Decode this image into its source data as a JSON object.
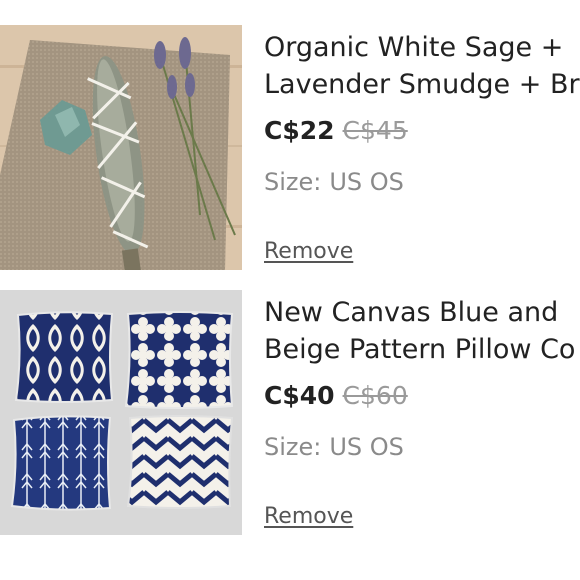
{
  "items": [
    {
      "title_lines": [
        "Organic White Sage +",
        "Lavender Smudge + Br."
      ],
      "price": "C$22",
      "original_price": "C$45",
      "size_label": "Size:",
      "size_value": "US OS",
      "remove_label": "Remove",
      "image": "sage-smudge-stick-with-lavender-and-crystal"
    },
    {
      "title_lines": [
        "New Canvas Blue and",
        "Beige Pattern Pillow Co"
      ],
      "price": "C$40",
      "original_price": "C$60",
      "size_label": "Size:",
      "size_value": "US OS",
      "remove_label": "Remove",
      "image": "four-navy-patterned-pillow-covers"
    }
  ],
  "colors": {
    "navy": "#1f2f6e",
    "burlap": "#a89a85",
    "wood": "#d9c3a8"
  }
}
